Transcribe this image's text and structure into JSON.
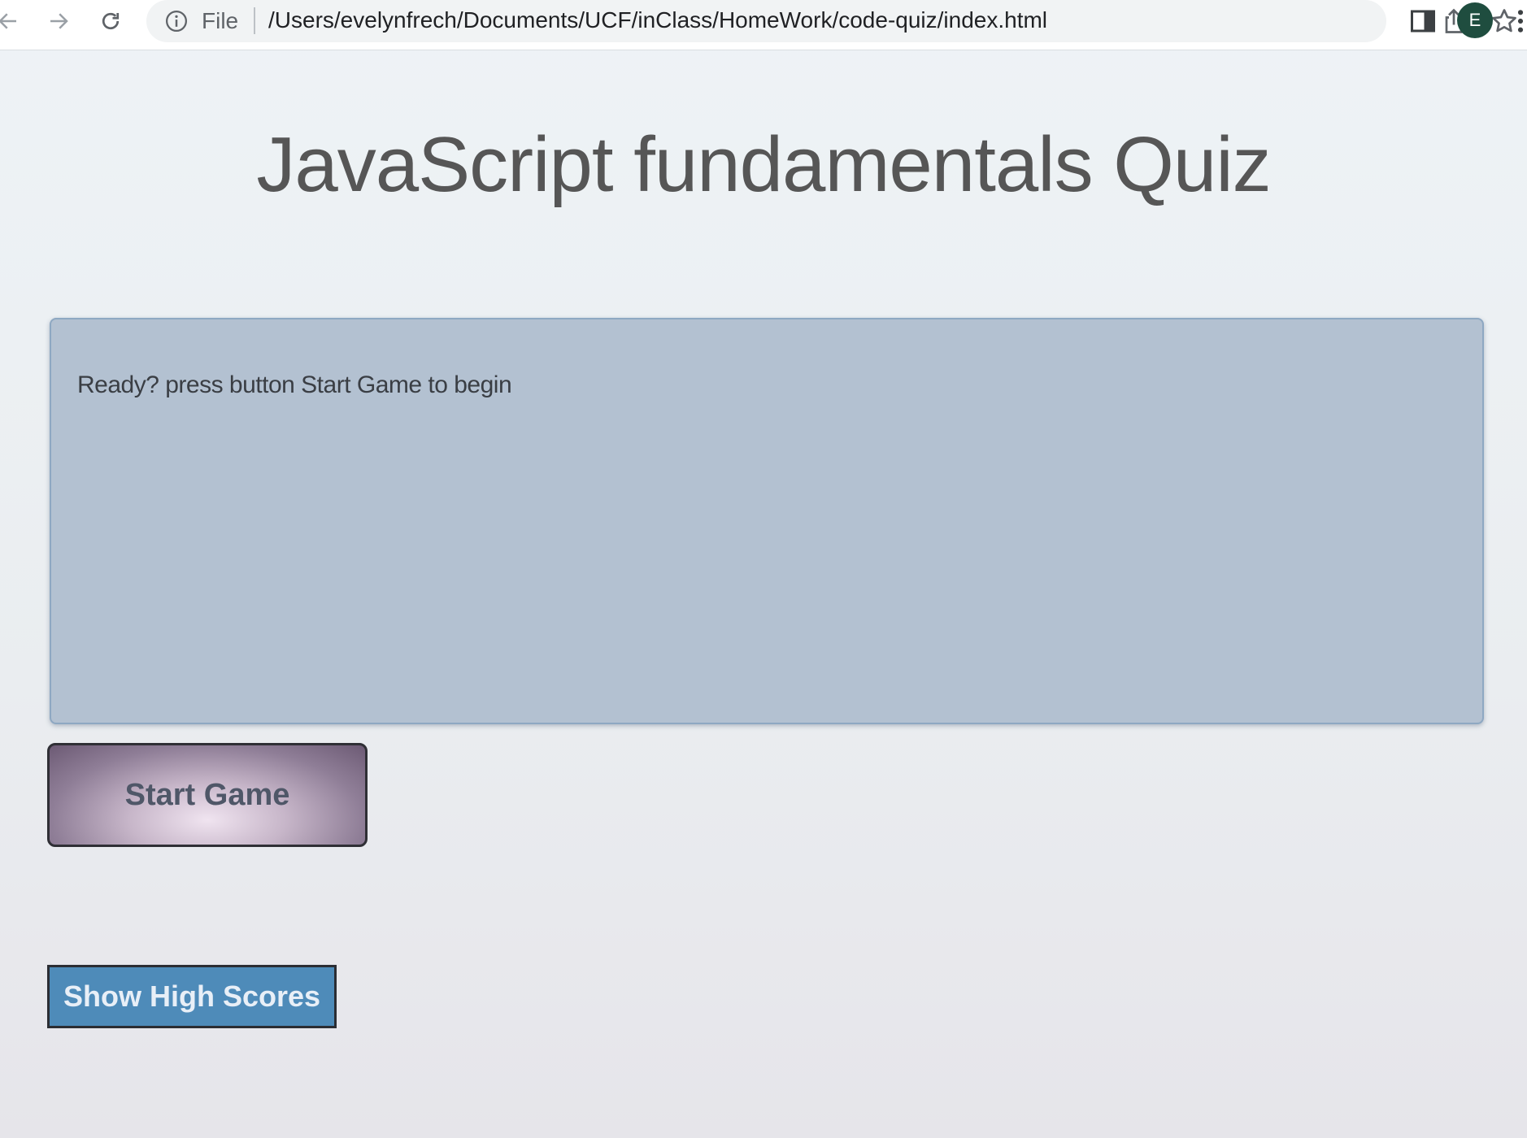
{
  "browser": {
    "file_label": "File",
    "url": "/Users/evelynfrech/Documents/UCF/inClass/HomeWork/code-quiz/index.html",
    "avatar_initial": "E",
    "avatar_color": "#1f4d3f",
    "icons": [
      "back-arrow-icon",
      "forward-arrow-icon",
      "reload-icon",
      "info-icon",
      "share-icon",
      "star-icon",
      "side-panel-icon",
      "kebab-menu-icon"
    ]
  },
  "page": {
    "title": "JavaScript fundamentals Quiz",
    "quiz_message": "Ready? press button Start Game to begin",
    "start_button_label": "Start Game",
    "highscores_button_label": "Show High Scores"
  },
  "colors": {
    "quiz_box": "#b3c1d1",
    "highscores_button": "#4e8bb9",
    "title_text": "#565656"
  }
}
